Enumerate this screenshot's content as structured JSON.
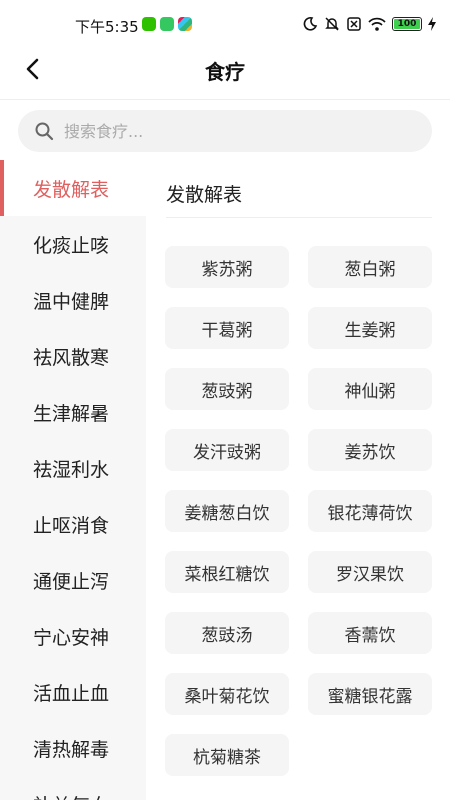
{
  "status_bar": {
    "time": "下午5:35",
    "battery": "100",
    "battery_level": 1.0,
    "icons": [
      "wechat-icon",
      "app-icon",
      "slack-icon",
      "moon-icon",
      "bell-muted-icon",
      "sim-x-icon",
      "wifi-icon",
      "battery-icon",
      "charging-icon"
    ]
  },
  "header": {
    "title": "食疗",
    "back_icon": "chevron-left-icon"
  },
  "search": {
    "placeholder": "搜索食疗..."
  },
  "sidebar": {
    "items": [
      {
        "label": "发散解表",
        "active": true
      },
      {
        "label": "化痰止咳"
      },
      {
        "label": "温中健脾"
      },
      {
        "label": "祛风散寒"
      },
      {
        "label": "生津解暑"
      },
      {
        "label": "祛湿利水"
      },
      {
        "label": "止呕消食"
      },
      {
        "label": "通便止泻"
      },
      {
        "label": "宁心安神"
      },
      {
        "label": "活血止血"
      },
      {
        "label": "清热解毒"
      },
      {
        "label": "补益气血"
      }
    ]
  },
  "main": {
    "section_title": "发散解表",
    "recipes": [
      "紫苏粥",
      "葱白粥",
      "干葛粥",
      "生姜粥",
      "葱豉粥",
      "神仙粥",
      "发汗豉粥",
      "姜苏饮",
      "姜糖葱白饮",
      "银花薄荷饮",
      "菜根红糖饮",
      "罗汉果饮",
      "葱豉汤",
      "香薷饮",
      "桑叶菊花饮",
      "蜜糖银花露",
      "杭菊糖茶"
    ]
  },
  "colors": {
    "accent": "#e06060",
    "sidebar_bg": "#f7f7f7",
    "chip_bg": "#f5f5f5"
  }
}
